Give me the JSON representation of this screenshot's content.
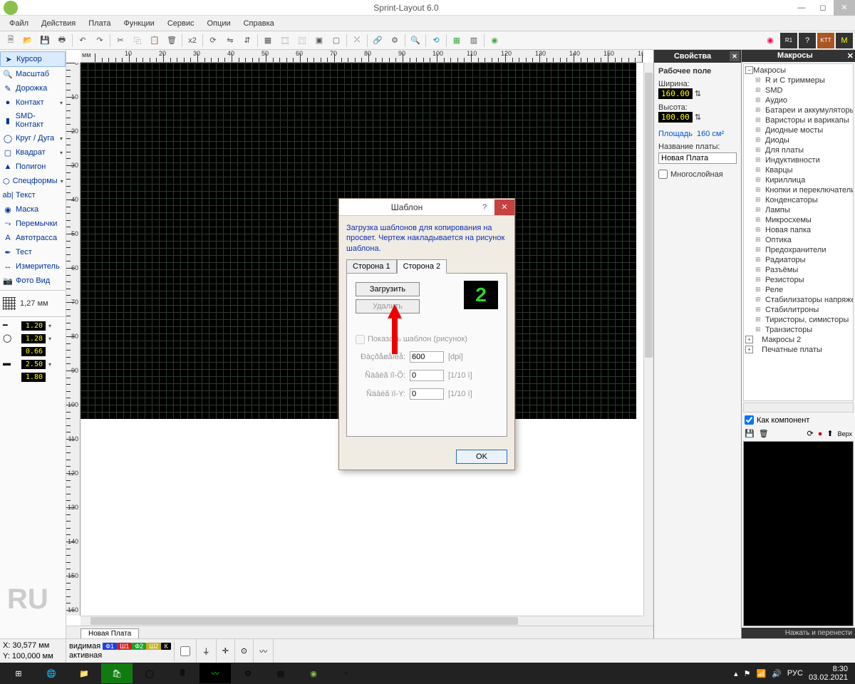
{
  "window": {
    "title": "Sprint-Layout 6.0"
  },
  "menu": [
    "Файл",
    "Действия",
    "Плата",
    "Функции",
    "Сервис",
    "Опции",
    "Справка"
  ],
  "left_tools": [
    {
      "label": "Курсор",
      "icon": "➤",
      "active": true
    },
    {
      "label": "Масштаб",
      "icon": "🔍"
    },
    {
      "label": "Дорожка",
      "icon": "✎"
    },
    {
      "label": "Контакт",
      "icon": "●",
      "dd": true
    },
    {
      "label": "SMD-Контакт",
      "icon": "▮"
    },
    {
      "label": "Круг / Дуга",
      "icon": "◯",
      "dd": true
    },
    {
      "label": "Квадрат",
      "icon": "▢",
      "dd": true
    },
    {
      "label": "Полигон",
      "icon": "▲"
    },
    {
      "label": "Спецформы",
      "icon": "⬡",
      "dd": true
    },
    {
      "label": "Текст",
      "icon": "ab|"
    },
    {
      "label": "Маска",
      "icon": "◉"
    },
    {
      "label": "Перемычки",
      "icon": "⤳"
    },
    {
      "label": "Автотрасса",
      "icon": "A"
    },
    {
      "label": "Тест",
      "icon": "✒"
    },
    {
      "label": "Измеритель",
      "icon": "↔"
    },
    {
      "label": "Фото Вид",
      "icon": "📷"
    }
  ],
  "grid_size": "1,27 мм",
  "params": [
    {
      "v": "1.20"
    },
    {
      "v": "1.28"
    },
    {
      "v": "0.66"
    },
    {
      "v": "2.50"
    },
    {
      "v": "1.80"
    }
  ],
  "lang_tag": "RU",
  "ruler_unit": "мм",
  "ruler_ticks": [
    "100",
    "110",
    "120",
    "130",
    "140",
    "150"
  ],
  "tab_label": "Новая Плата",
  "properties": {
    "title": "Свойства",
    "section": "Рабочее поле",
    "width_label": "Ширина:",
    "width_val": "160.00",
    "height_label": "Высота:",
    "height_val": "100.00",
    "area_label": "Площадь",
    "area_val": "160 см²",
    "name_label": "Название платы:",
    "name_val": "Новая Плата",
    "multilayer": "Многослойная"
  },
  "macros": {
    "title": "Макросы",
    "root": "Макросы",
    "items": [
      "R и C триммеры",
      "SMD",
      "Аудио",
      "Батареи и аккумуляторы",
      "Варисторы и варикапы",
      "Диодные мосты",
      "Диоды",
      "Для платы",
      "Индуктивности",
      "Кварцы",
      "Кириллица",
      "Кнопки и переключатели",
      "Конденсаторы",
      "Лампы",
      "Микросхемы",
      "Новая папка",
      "Оптика",
      "Предохранители",
      "Радиаторы",
      "Разъёмы",
      "Резисторы",
      "Реле",
      "Стабилизаторы напряжения",
      "Стабилитроны",
      "Тиристоры, симисторы",
      "Транзисторы"
    ],
    "extra": [
      "Макросы 2",
      "Печатные платы"
    ],
    "as_component": "Как компонент",
    "footer": "Нажать и перенести"
  },
  "status": {
    "x_label": "X:",
    "x_val": "30,577 мм",
    "y_label": "Y:",
    "y_val": "100,000 мм",
    "visible": "видимая",
    "active": "активная",
    "layers": [
      {
        "name": "Ф1",
        "bg": "#2040e0"
      },
      {
        "name": "Ш1",
        "bg": "#d02020"
      },
      {
        "name": "Ф2",
        "bg": "#20a030"
      },
      {
        "name": "Ш2",
        "bg": "#c0b020"
      },
      {
        "name": "К",
        "bg": "#000"
      }
    ]
  },
  "dialog": {
    "title": "Шаблон",
    "desc": "Загрузка шаблонов для копирования на просвет. Чертеж накладывается на рисунок шаблона.",
    "tab1": "Сторона 1",
    "tab2": "Сторона 2",
    "load": "Загрузить",
    "delete": "Удалить",
    "badge": "2",
    "show": "Показать шаблон (рисунок)",
    "row1_label": "Ðàçðåøåíèå:",
    "row1_val": "600",
    "row1_unit": "[dpi]",
    "row2_label": "Ñäâèã ïî-Õ:",
    "row2_val": "0",
    "row2_unit": "[1/10 ì]",
    "row3_label": "Ñäâèã ïî-Y:",
    "row3_val": "0",
    "row3_unit": "[1/10 ì]",
    "ok": "OK"
  },
  "taskbar": {
    "lang": "РУС",
    "time": "8:30",
    "date": "03.02.2021"
  }
}
